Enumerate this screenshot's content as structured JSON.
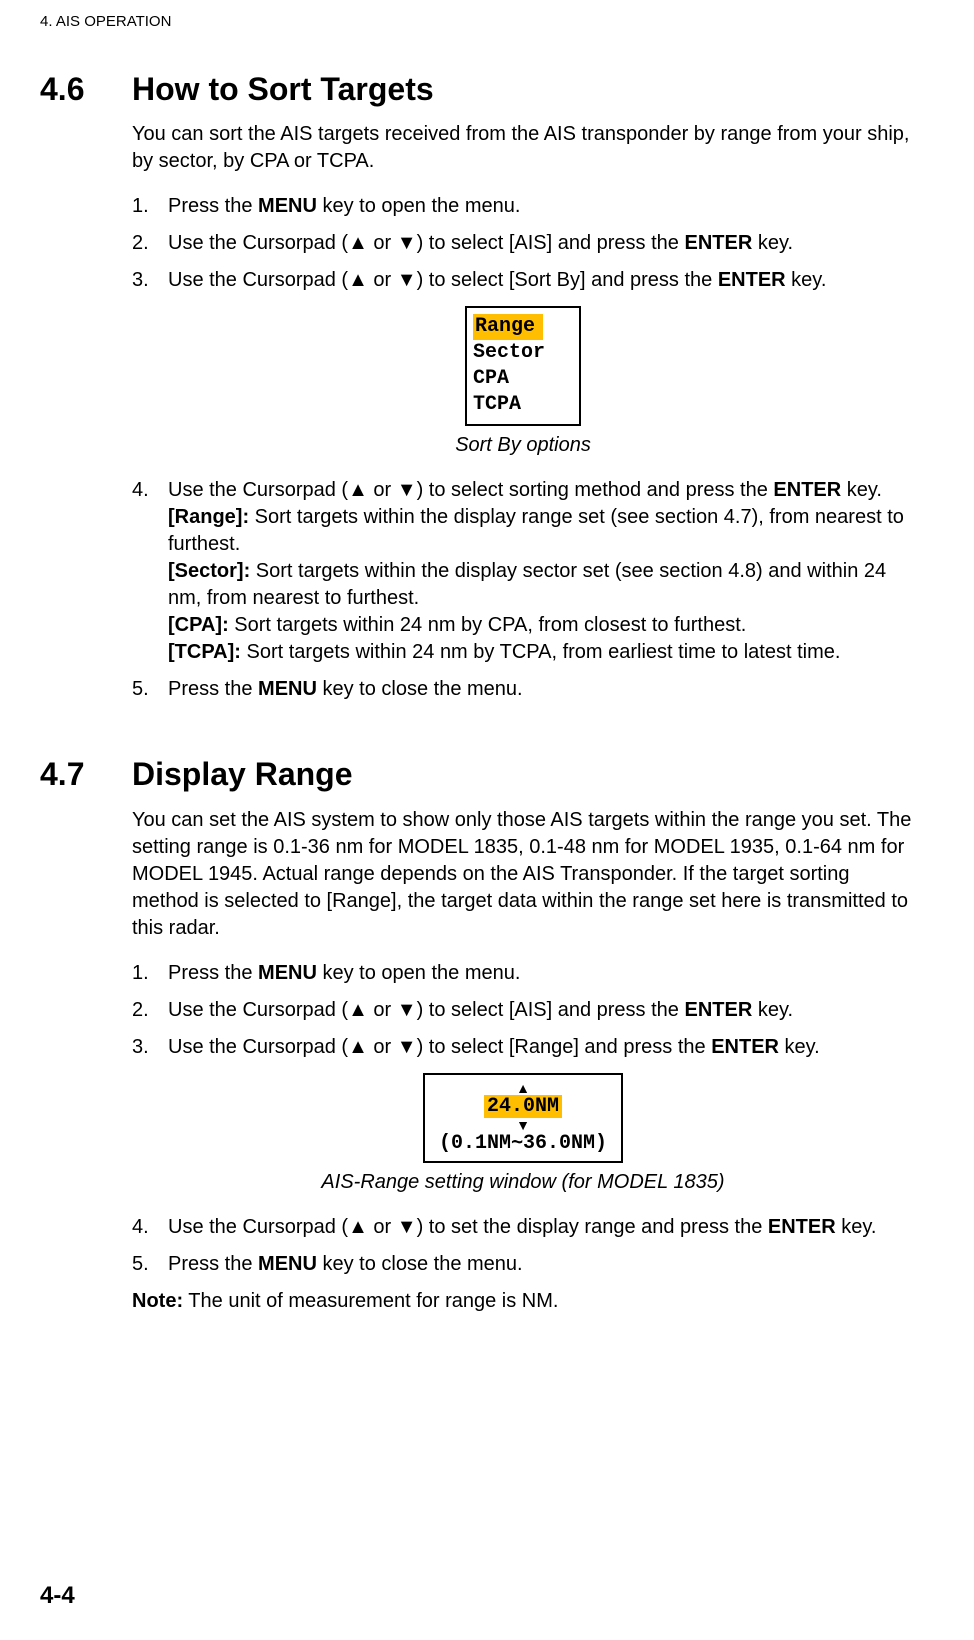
{
  "runningHead": "4.  AIS OPERATION",
  "pageNumber": "4-4",
  "sections": [
    {
      "num": "4.6",
      "title": "How to Sort Targets",
      "intro": "You can sort the AIS targets received from the AIS transponder by range from your ship, by sector, by CPA or TCPA.",
      "steps": [
        {
          "n": "1.",
          "pre": "Press the ",
          "bold1": "MENU",
          "post": " key to open the menu."
        },
        {
          "n": "2.",
          "pre": "Use the Cursorpad (▲ or ▼) to select [AIS] and press the ",
          "bold1": "ENTER",
          "post": " key."
        },
        {
          "n": "3.",
          "pre": "Use the Cursorpad (▲ or ▼) to select [Sort By] and press the ",
          "bold1": "ENTER",
          "post": " key."
        }
      ],
      "fig1": {
        "opt1": "Range",
        "opt2": "Sector",
        "opt3": "CPA",
        "opt4": "TCPA",
        "caption": "Sort By options"
      },
      "steps2": [
        {
          "n": "4.",
          "pre": "Use the Cursorpad (▲ or ▼) to select sorting method and press the ",
          "bold1": "ENTER",
          "post": " key.",
          "lines": [
            {
              "label": "[Range]:",
              "text": " Sort targets within the display range set (see section 4.7), from nearest to furthest."
            },
            {
              "label": "[Sector]:",
              "text": " Sort targets within the display sector set (see section 4.8) and within 24 nm, from nearest to furthest."
            },
            {
              "label": "[CPA]:",
              "text": " Sort targets within 24 nm by CPA, from closest to furthest."
            },
            {
              "label": "[TCPA]:",
              "text": " Sort targets within 24 nm by TCPA, from earliest time to latest time."
            }
          ]
        },
        {
          "n": "5.",
          "pre": "Press the ",
          "bold1": "MENU",
          "post": " key to close the menu."
        }
      ]
    },
    {
      "num": "4.7",
      "title": "Display Range",
      "intro": "You can set the AIS system to show only those AIS targets within the range you set. The setting range is 0.1-36 nm for MODEL 1835, 0.1-48 nm for MODEL 1935, 0.1-64 nm for MODEL 1945. Actual range depends on the AIS Transponder. If the target sorting method is selected to [Range], the target data within the range set here is transmitted to this radar.",
      "steps": [
        {
          "n": "1.",
          "pre": "Press the ",
          "bold1": "MENU",
          "post": " key to open the menu."
        },
        {
          "n": "2.",
          "pre": "Use the Cursorpad (▲ or ▼) to select [AIS] and press the ",
          "bold1": "ENTER",
          "post": " key."
        },
        {
          "n": "3.",
          "pre": "Use the Cursorpad (▲ or ▼) to select [Range] and press the ",
          "bold1": "ENTER",
          "post": " key."
        }
      ],
      "fig1": {
        "val": "24.0NM",
        "rangeText": "(0.1NM∼36.0NM)",
        "caption": "AIS-Range setting window (for MODEL 1835)"
      },
      "steps2": [
        {
          "n": "4.",
          "pre": "Use the Cursorpad (▲ or ▼) to set the display range and press the ",
          "bold1": "ENTER",
          "post": " key."
        },
        {
          "n": "5.",
          "pre": "Press the ",
          "bold1": "MENU",
          "post": " key to close the menu."
        }
      ],
      "noteLabel": "Note:",
      "noteText": " The unit of measurement for range is NM."
    }
  ]
}
